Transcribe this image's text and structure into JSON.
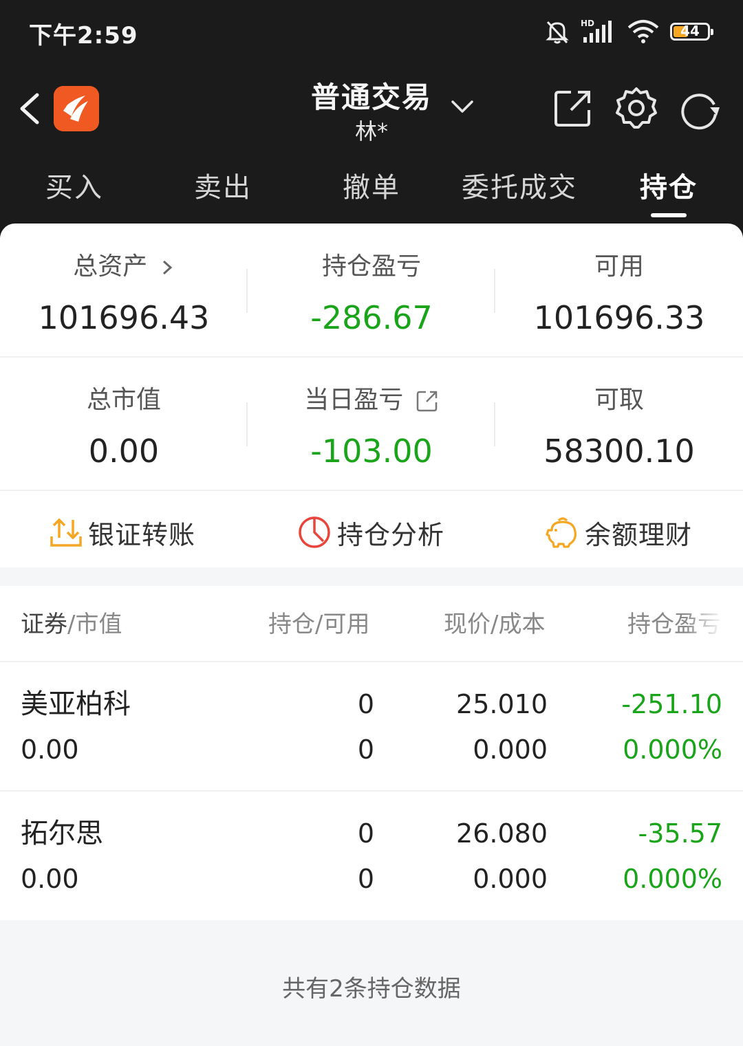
{
  "status_bar": {
    "time": "下午2:59",
    "battery": "44",
    "battery_level": 0.44,
    "icons": [
      "bell-muted-icon",
      "hd-signal-icon",
      "wifi-icon",
      "battery-icon"
    ]
  },
  "nav": {
    "title": "普通交易",
    "account": "林*",
    "icons": [
      "back-icon",
      "app-logo",
      "chevron-down-icon",
      "share-icon",
      "gear-icon",
      "refresh-icon"
    ]
  },
  "tabs": [
    {
      "label": "买入"
    },
    {
      "label": "卖出"
    },
    {
      "label": "撤单"
    },
    {
      "label": "委托成交"
    },
    {
      "label": "持仓",
      "active": true
    }
  ],
  "summary": {
    "total_assets": {
      "label": "总资产",
      "value": "101696.43"
    },
    "position_pl": {
      "label": "持仓盈亏",
      "value": "-286.67"
    },
    "available": {
      "label": "可用",
      "value": "101696.33"
    },
    "market_value": {
      "label": "总市值",
      "value": "0.00"
    },
    "daily_pl": {
      "label": "当日盈亏",
      "value": "-103.00"
    },
    "withdrawable": {
      "label": "可取",
      "value": "58300.10"
    }
  },
  "actions": [
    {
      "label": "银证转账",
      "icon": "transfer-icon"
    },
    {
      "label": "持仓分析",
      "icon": "pie-chart-icon"
    },
    {
      "label": "余额理财",
      "icon": "piggy-bank-icon"
    }
  ],
  "table": {
    "headers": {
      "security_a": "证券",
      "security_b": "/市值",
      "position": "持仓/可用",
      "price": "现价/成本",
      "pl": "持仓盈亏"
    },
    "rows": [
      {
        "name": "美亚柏科",
        "market_value": "0.00",
        "position": "0",
        "available": "0",
        "price": "25.010",
        "cost": "0.000",
        "pl": "-251.10",
        "pl_pct": "0.000%"
      },
      {
        "name": "拓尔思",
        "market_value": "0.00",
        "position": "0",
        "available": "0",
        "price": "26.080",
        "cost": "0.000",
        "pl": "-35.57",
        "pl_pct": "0.000%"
      }
    ]
  },
  "footer": "共有2条持仓数据",
  "colors": {
    "topbar": "#1b1b1b",
    "loss_green": "#1aa41a",
    "brand_orange": "#f05a22",
    "action_orange": "#f5a623",
    "action_red": "#e8453c"
  }
}
